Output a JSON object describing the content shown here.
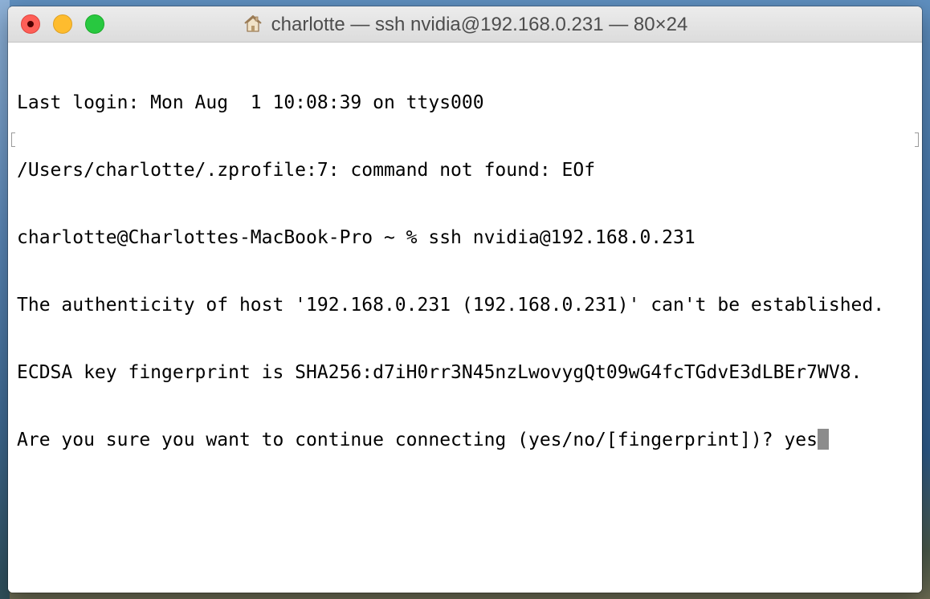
{
  "window": {
    "title": "charlotte — ssh nvidia@192.168.0.231 — 80×24",
    "title_icon": "home-folder-icon"
  },
  "colors": {
    "close": "#fe5f57",
    "minimize": "#febc2e",
    "zoom": "#28c840",
    "cursor": "#8c8c8c"
  },
  "terminal": {
    "lines": [
      "Last login: Mon Aug  1 10:08:39 on ttys000",
      "/Users/charlotte/.zprofile:7: command not found: EOf",
      "charlotte@Charlottes-MacBook-Pro ~ % ssh nvidia@192.168.0.231",
      "The authenticity of host '192.168.0.231 (192.168.0.231)' can't be established.",
      "ECDSA key fingerprint is SHA256:d7iH0rr3N45nzLwovygQt09wG4fcTGdvE3dLBEr7WV8.",
      "Are you sure you want to continue connecting (yes/no/[fingerprint])? yes"
    ]
  }
}
